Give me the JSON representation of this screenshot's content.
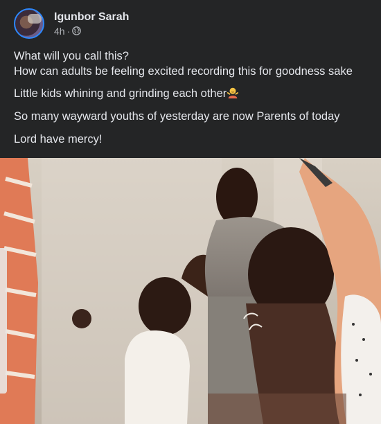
{
  "post": {
    "author": "Igunbor Sarah",
    "time": "4h",
    "separator": "·",
    "privacy_icon": "globe-icon",
    "lines": [
      "What will you call this?",
      "How can adults be feeling excited recording this for goodness sake",
      "Little kids whining and grinding each other",
      "So many wayward youths of yesterday are now Parents of today",
      "Lord have mercy!"
    ],
    "emoji_icon": "person-shrugging-emoji"
  },
  "media": {
    "type": "video-still",
    "description_icon": "video-frame"
  },
  "colors": {
    "background": "#242526",
    "text_primary": "#e4e6eb",
    "text_secondary": "#b0b3b8",
    "avatar_ring": "#2d88ff"
  }
}
